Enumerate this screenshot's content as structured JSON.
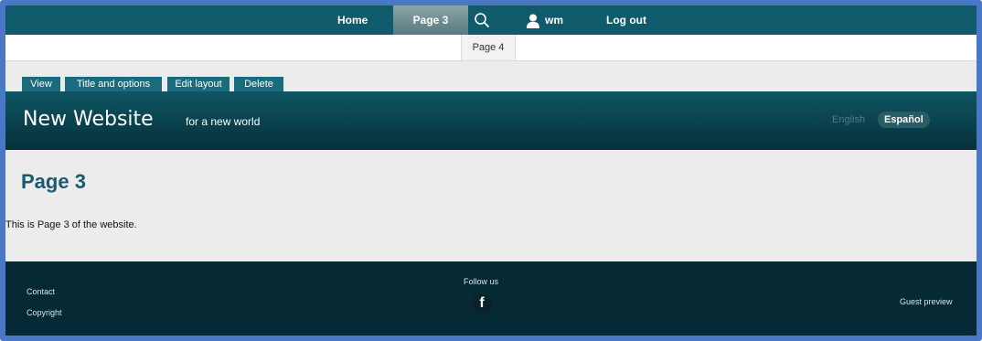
{
  "nav": {
    "home": "Home",
    "page3": "Page 3",
    "user": "wm",
    "logout": "Log out",
    "search_icon": "search-icon",
    "user_icon": "user-icon"
  },
  "dropdown": {
    "item": "Page 4"
  },
  "tabs": [
    {
      "label": "View"
    },
    {
      "label": "Title and options"
    },
    {
      "label": "Edit layout"
    },
    {
      "label": "Delete"
    }
  ],
  "header": {
    "site_title": "New Website",
    "slogan": "for a new world",
    "languages": [
      "English",
      "Español"
    ],
    "active_language": "Español"
  },
  "main": {
    "heading": "Page 3",
    "text": "This is Page 3 of the website."
  },
  "footer": {
    "contact": "Contact",
    "copyright": "Copyright",
    "follow": "Follow us",
    "facebook_icon": "f",
    "guest": "Guest preview"
  },
  "colors": {
    "frame_border": "#4a78c6",
    "nav_bg": "#0f5b6b",
    "header_bg": "#0a4250",
    "footer_bg": "#052a35",
    "heading": "#1a5a6e"
  }
}
